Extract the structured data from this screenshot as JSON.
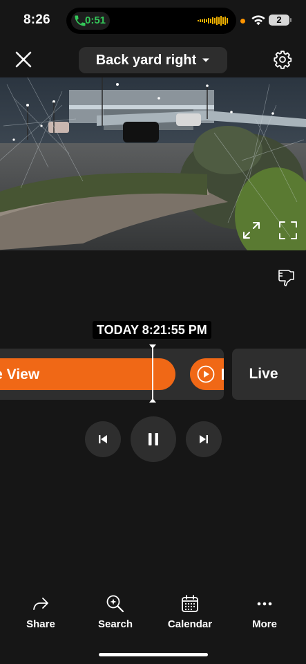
{
  "status_bar": {
    "time": "8:26",
    "call_timer": "0:51",
    "battery": "2",
    "icons": [
      "phone-icon",
      "audio-wave-icon",
      "mic-indicator-dot",
      "wifi-icon",
      "battery-icon"
    ],
    "colors": {
      "call": "#34c759",
      "indicator": "#ff9500"
    }
  },
  "header": {
    "camera_name": "Back yard right",
    "icons": [
      "close-icon",
      "chevron-down-icon",
      "gear-icon"
    ]
  },
  "video": {
    "icons": [
      "expand-icon",
      "fullscreen-icon"
    ]
  },
  "feedback": {
    "icon": "thumbs-down-icon"
  },
  "timeline": {
    "timestamp": "TODAY 8:21:55 PM",
    "event_label": "re View",
    "live_label": "Live",
    "accent_color": "#f06816"
  },
  "playback": {
    "icons": [
      "skip-previous-icon",
      "pause-icon",
      "skip-next-icon"
    ]
  },
  "bottom_nav": {
    "items": [
      {
        "label": "Share",
        "icon": "share-icon"
      },
      {
        "label": "Search",
        "icon": "search-icon"
      },
      {
        "label": "Calendar",
        "icon": "calendar-icon"
      },
      {
        "label": "More",
        "icon": "more-icon"
      }
    ]
  }
}
